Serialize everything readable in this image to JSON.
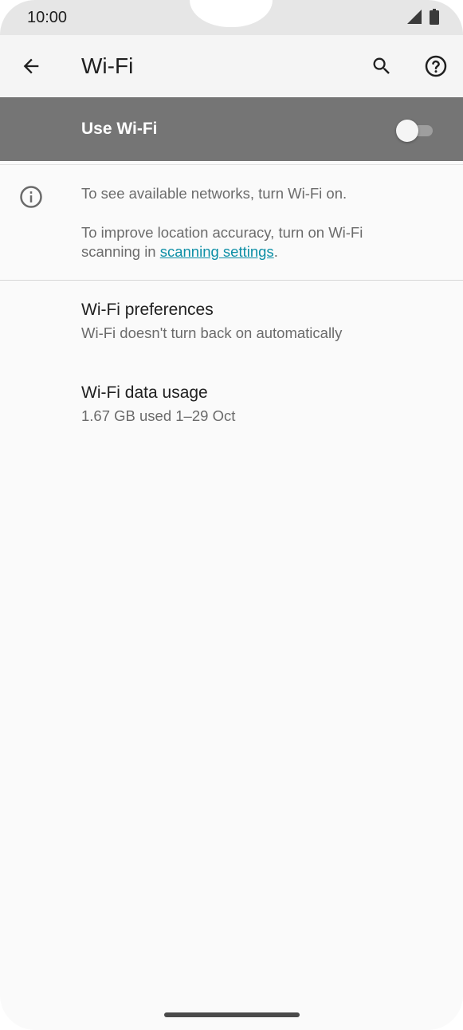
{
  "status_bar": {
    "time": "10:00",
    "icons": [
      "cellular-signal-icon",
      "battery-icon"
    ]
  },
  "app_bar": {
    "title": "Wi-Fi",
    "icons": [
      "back-arrow-icon",
      "search-icon",
      "help-icon"
    ]
  },
  "master_switch": {
    "label": "Use Wi-Fi",
    "enabled": false
  },
  "info": {
    "line1": "To see available networks, turn Wi-Fi on.",
    "line2_prefix": "To improve location accuracy, turn on Wi-Fi scanning in ",
    "link": "scanning settings",
    "line2_suffix": "."
  },
  "preferences": [
    {
      "title": "Wi-Fi preferences",
      "summary": "Wi-Fi doesn't turn back on automatically"
    },
    {
      "title": "Wi-Fi data usage",
      "summary": "1.67 GB used 1–29 Oct"
    }
  ],
  "colors": {
    "master_bar": "#757575",
    "link": "#0d8fa6",
    "background": "#fafafa"
  }
}
